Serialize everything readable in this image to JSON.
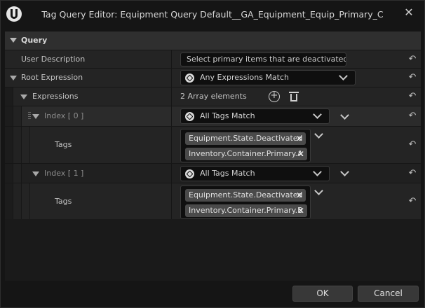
{
  "window": {
    "title": "Tag Query Editor: Equipment Query Default__GA_Equipment_Equip_Primary_C"
  },
  "section": {
    "label": "Query"
  },
  "rows": {
    "user_description": {
      "label": "User Description",
      "value": "Select primary items that are deactivated."
    },
    "root_expression": {
      "label": "Root Expression",
      "value": "Any Expressions Match"
    },
    "expressions": {
      "label": "Expressions",
      "count": "2 Array elements"
    },
    "index0": {
      "label": "Index [ 0 ]",
      "value": "All Tags Match"
    },
    "tags0": {
      "label": "Tags",
      "items": [
        "Equipment.State.Deactivated",
        "Inventory.Container.Primary.A"
      ]
    },
    "index1": {
      "label": "Index [ 1 ]",
      "value": "All Tags Match"
    },
    "tags1": {
      "label": "Tags",
      "items": [
        "Equipment.State.Deactivated",
        "Inventory.Container.Primary.B"
      ]
    }
  },
  "buttons": {
    "ok": "OK",
    "cancel": "Cancel"
  },
  "icons": {
    "logo": "unreal-logo-icon",
    "close": "close-icon",
    "reset": "reset-arrow-icon",
    "add": "add-element-icon",
    "delete": "delete-all-icon",
    "expression_type": "expression-type-icon",
    "dropdown": "chevron-down-icon",
    "remove_tag": "remove-tag-icon"
  }
}
